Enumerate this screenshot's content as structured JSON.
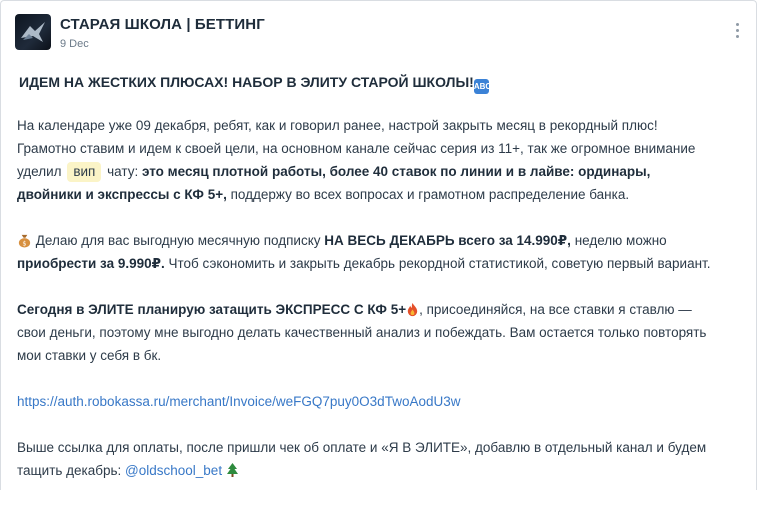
{
  "channel": {
    "name": "СТАРАЯ ШКОЛА | БЕТТИНГ",
    "date": "9 Dec"
  },
  "post": {
    "headline": "ИДЕМ НА ЖЕСТКИХ ПЛЮСАХ! НАБОР В ЭЛИТУ СТАРОЙ ШКОЛЫ!",
    "p1_text1": "На календаре уже 09 декабря, ребят, как и говорил ранее, настрой закрыть месяц в рекордный плюс! Грамотно ставим и идем к своей цели, на основном канале сейчас серия из 11+, так же огромное внимание уделил",
    "p1_tag": "вип",
    "p1_text2": "чату:",
    "p1_bold": "это месяц плотной работы, более 40 ставок по линии и в лайве: ординары, двойники и экспрессы с КФ 5+,",
    "p1_text3": "поддержу во всех вопросах и грамотном распределение банка.",
    "p2_text1": "Делаю для вас выгодную месячную подписку",
    "p2_bold1": "НА ВЕСЬ ДЕКАБРЬ всего за 14.990₽,",
    "p2_text2": "неделю можно",
    "p2_bold2": "приобрести за 9.990₽.",
    "p2_text3": "Чтоб сэкономить и закрыть декабрь рекордной статистикой, советую первый вариант.",
    "p3_bold": "Сегодня в ЭЛИТЕ планирую затащить ЭКСПРЕСС С КФ 5+",
    "p3_text": ", присоединяйся, на все ставки я ставлю — свои деньги, поэтому мне выгодно делать качественный анализ и побеждать. Вам остается только повторять мои ставки у себя в бк.",
    "payment_link": "https://auth.robokassa.ru/merchant/Invoice/weFGQ7puy0O3dTwoAodU3w",
    "p5_text": "Выше ссылка для оплаты, после пришли чек об оплате и «Я В ЭЛИТЕ», добавлю в отдельный канал и будем тащить декабрь:",
    "mention": "@oldschool_bet"
  },
  "icons": {
    "headline_emoji": "abcd-emoji-icon",
    "money": "moneybag-emoji-icon",
    "fire": "fire-emoji-icon",
    "tree": "christmas-tree-emoji-icon",
    "menu": "more-vertical-icon"
  },
  "colors": {
    "link": "#3878c7",
    "tag_background": "#fbf4c7"
  }
}
